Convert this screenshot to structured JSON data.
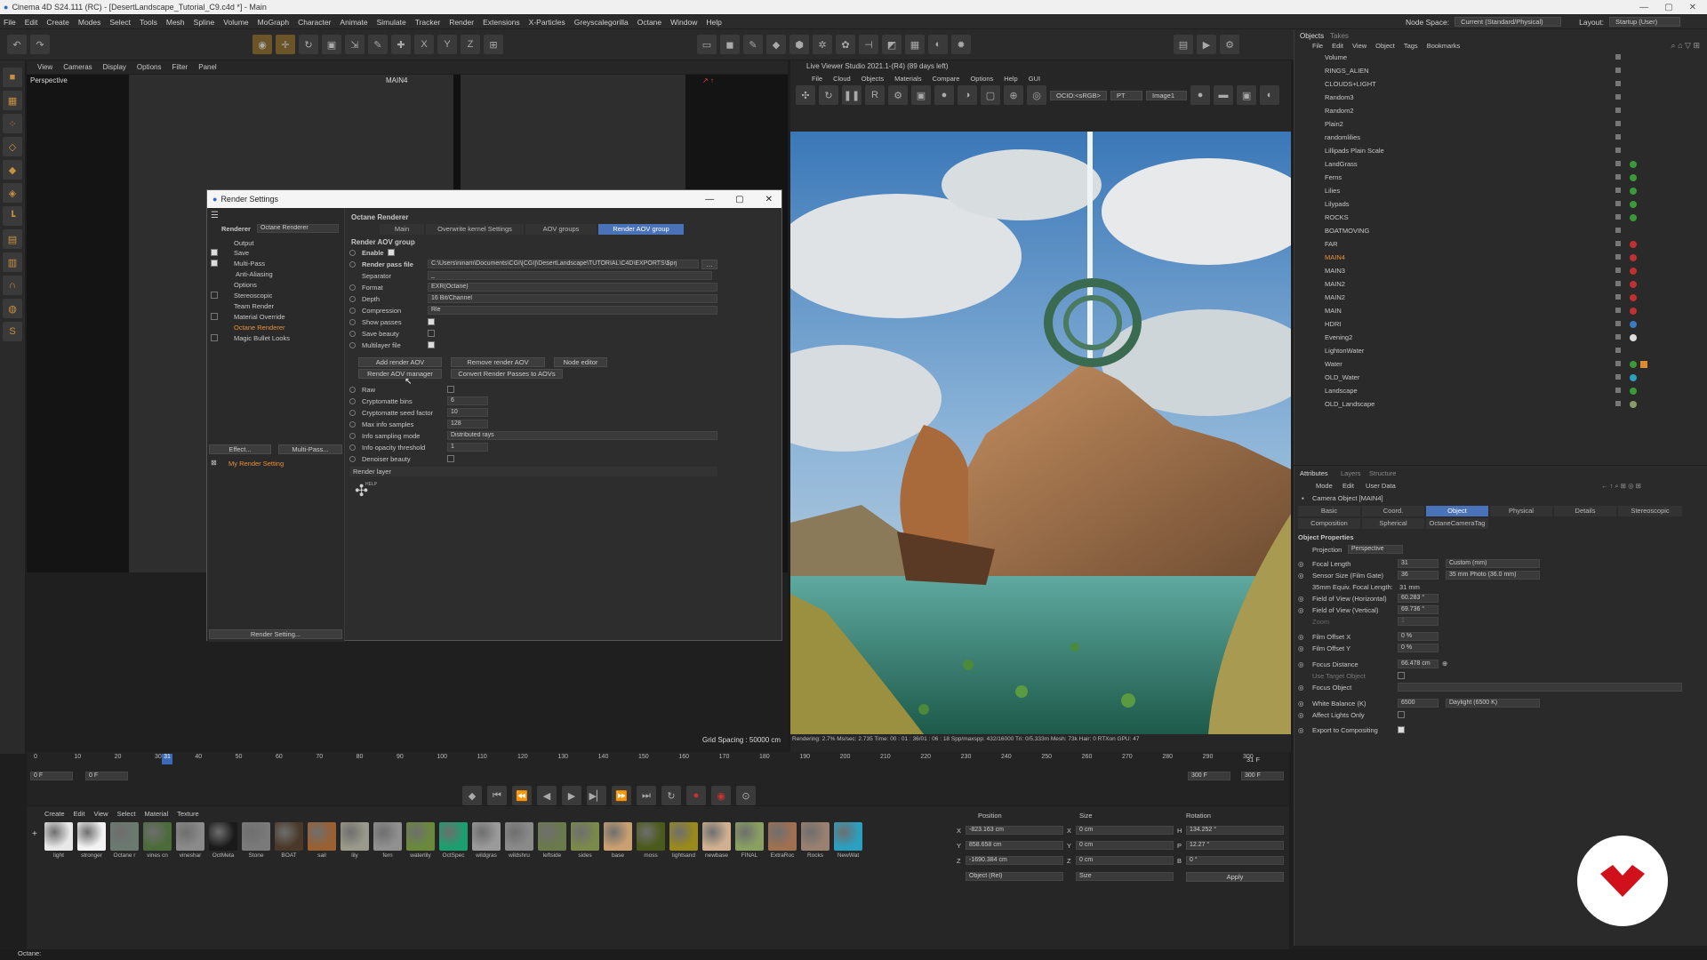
{
  "window": {
    "title": "Cinema 4D S24.111 (RC) - [DesertLandscape_Tutorial_C9.c4d *] - Main"
  },
  "menubar": {
    "items": [
      "File",
      "Edit",
      "Create",
      "Modes",
      "Select",
      "Tools",
      "Mesh",
      "Spline",
      "Volume",
      "MoGraph",
      "Character",
      "Animate",
      "Simulate",
      "Tracker",
      "Render",
      "Extensions",
      "X-Particles",
      "Greyscalegorilla",
      "Octane",
      "Window",
      "Help"
    ],
    "node_space_label": "Node Space:",
    "node_space_value": "Current (Standard/Physical)",
    "layout_label": "Layout:",
    "layout_value": "Startup (User)"
  },
  "viewport": {
    "menu": [
      "View",
      "Cameras",
      "Display",
      "Options",
      "Filter",
      "Panel"
    ],
    "name": "Perspective",
    "camera_label": "MAIN4",
    "grid_spacing": "Grid Spacing : 50000 cm"
  },
  "render_settings": {
    "title": "Render Settings",
    "renderer_label": "Renderer",
    "renderer_value": "Octane Renderer",
    "tree": [
      "Output",
      "Save",
      "Multi-Pass",
      "Anti-Aliasing",
      "Options",
      "Stereoscopic",
      "Team Render",
      "Material Override",
      "Octane Renderer",
      "Magic Bullet Looks"
    ],
    "effect_button": "Effect...",
    "multipass_button": "Multi-Pass...",
    "preset_name": "My Render Setting",
    "render_setting_button": "Render Setting...",
    "section_title": "Octane Renderer",
    "tabs": [
      "Main",
      "Overwrite kernel Settings",
      "AOV groups",
      "Render AOV group"
    ],
    "group_title": "Render AOV group",
    "enable_label": "Enable",
    "render_pass_file_label": "Render pass file",
    "render_pass_file_value": "C:\\Users\\ninam\\Documents\\CGI\\[CGI]\\DesertLandscape\\TUTORIAL\\C4D\\EXPORTS\\$prj",
    "separator_label": "Separator",
    "separator_value": "_",
    "format_label": "Format",
    "format_value": "EXR(Octane)",
    "depth_label": "Depth",
    "depth_value": "16 Bit/Channel",
    "compression_label": "Compression",
    "compression_value": "Rle",
    "show_passes_label": "Show passes",
    "save_beauty_label": "Save beauty",
    "multilayer_label": "Multilayer file",
    "add_aov_button": "Add render AOV",
    "remove_aov_button": "Remove render AOV",
    "node_editor_button": "Node editor",
    "aov_manager_button": "Render AOV manager",
    "convert_button": "Convert Render Passes to AOVs",
    "raw_label": "Raw",
    "crypto_bins_label": "Cryptomatte bins",
    "crypto_bins_value": "6",
    "crypto_seed_label": "Cryptomatte seed factor",
    "crypto_seed_value": "10",
    "max_info_label": "Max info samples",
    "max_info_value": "128",
    "info_sampling_label": "Info sampling mode",
    "info_sampling_value": "Distributed rays",
    "info_opacity_label": "Info opacity threshold",
    "info_opacity_value": "1",
    "denoiser_label": "Denoiser beauty",
    "render_layer_label": "Render layer",
    "help_label": "HELP"
  },
  "live_viewer": {
    "title": "Live Viewer Studio 2021.1-(R4) (89 days left)",
    "menu": [
      "File",
      "Cloud",
      "Objects",
      "Materials",
      "Compare",
      "Options",
      "Help",
      "GUI"
    ],
    "ocio_value": "OCIO:<sRGB>",
    "pt_value": "PT",
    "image_value": "Image1",
    "status": "Rendering: 2.7%  Ms/sec: 2.735  Time: 00 : 01 : 36/01 : 06 : 18  Spp/maxspp: 432/16000  Tri: 0/5.333m  Mesh: 73k  Hair: 0  RTXon  GPU: 47"
  },
  "objects_panel": {
    "tabs": [
      "Objects",
      "Takes"
    ],
    "menu": [
      "File",
      "Edit",
      "View",
      "Object",
      "Tags",
      "Bookmarks"
    ],
    "items": [
      {
        "name": "Volume",
        "highlight": false
      },
      {
        "name": "RINGS_ALIEN",
        "highlight": false
      },
      {
        "name": "CLOUDS+LIGHT",
        "highlight": false
      },
      {
        "name": "Random3",
        "highlight": false
      },
      {
        "name": "Random2",
        "highlight": false
      },
      {
        "name": "Plain2",
        "highlight": false
      },
      {
        "name": "randomlilies",
        "highlight": false
      },
      {
        "name": "Lillipads Plain Scale",
        "highlight": false
      },
      {
        "name": "LandGrass",
        "highlight": false
      },
      {
        "name": "Ferns",
        "highlight": false
      },
      {
        "name": "Lilies",
        "highlight": false
      },
      {
        "name": "Lilypads",
        "highlight": false
      },
      {
        "name": "ROCKS",
        "highlight": false
      },
      {
        "name": "BOATMOVING",
        "highlight": false
      },
      {
        "name": "FAR",
        "highlight": false
      },
      {
        "name": "MAIN4",
        "highlight": true
      },
      {
        "name": "MAIN3",
        "highlight": false
      },
      {
        "name": "MAIN2",
        "highlight": false
      },
      {
        "name": "MAIN2",
        "highlight": false
      },
      {
        "name": "MAIN",
        "highlight": false
      },
      {
        "name": "HDRI",
        "highlight": false
      },
      {
        "name": "Evening2",
        "highlight": false
      },
      {
        "name": "LightonWater",
        "highlight": false
      },
      {
        "name": "Water",
        "highlight": false
      },
      {
        "name": "OLD_Water",
        "highlight": false
      },
      {
        "name": "Landscape",
        "highlight": false
      },
      {
        "name": "OLD_Landscape",
        "highlight": false
      }
    ]
  },
  "attributes": {
    "tabs": [
      "Attributes",
      "Layers",
      "Structure"
    ],
    "menu": [
      "Mode",
      "Edit",
      "User Data"
    ],
    "object_title": "Camera Object [MAIN4]",
    "subtabs_row1": [
      "Basic",
      "Coord.",
      "Object",
      "Physical",
      "Details",
      "Stereoscopic"
    ],
    "subtabs_row2": [
      "Composition",
      "Spherical",
      "OctaneCameraTag"
    ],
    "section": "Object Properties",
    "projection_label": "Projection",
    "projection_value": "Perspective",
    "focal_label": "Focal Length",
    "focal_value": "31",
    "focal_preset": "Custom (mm)",
    "sensor_label": "Sensor Size (Film Gate)",
    "sensor_value": "36",
    "sensor_preset": "35 mm Photo (36.0 mm)",
    "equiv_label": "35mm Equiv. Focal Length:",
    "equiv_value": "31 mm",
    "fovh_label": "Field of View (Horizontal)",
    "fovh_value": "60.283 °",
    "fovv_label": "Field of View (Vertical)",
    "fovv_value": "69.736 °",
    "zoom_label": "Zoom",
    "zoom_value": "1",
    "fox_label": "Film Offset X",
    "fox_value": "0 %",
    "foy_label": "Film Offset Y",
    "foy_value": "0 %",
    "focus_label": "Focus Distance",
    "focus_value": "66.478 cm",
    "use_target_label": "Use Target Object",
    "focus_obj_label": "Focus Object",
    "wb_label": "White Balance (K)",
    "wb_value": "6500",
    "wb_preset": "Daylight (6500 K)",
    "affect_label": "Affect Lights Only",
    "export_label": "Export to Compositing"
  },
  "timeline": {
    "ticks": [
      "0",
      "10",
      "20",
      "30",
      "40",
      "50",
      "60",
      "70",
      "80",
      "90",
      "100",
      "110",
      "120",
      "130",
      "140",
      "150",
      "160",
      "170",
      "180",
      "190",
      "200",
      "210",
      "220",
      "230",
      "240",
      "250",
      "260",
      "270",
      "280",
      "290",
      "300"
    ],
    "current_frame": "31 F",
    "start_a": "0 F",
    "start_b": "0 F",
    "end_a": "300 F",
    "end_b": "300 F",
    "marker": "31"
  },
  "materials": {
    "menu": [
      "Create",
      "Edit",
      "View",
      "Select",
      "Material",
      "Texture"
    ],
    "items": [
      {
        "name": "light",
        "color": "#e8e8e8"
      },
      {
        "name": "stronger",
        "color": "#f2f2f2"
      },
      {
        "name": "Octane r",
        "color": "#6a7a70"
      },
      {
        "name": "vines cn",
        "color": "#4b6b3a"
      },
      {
        "name": "vineshar",
        "color": "#8a8a8a"
      },
      {
        "name": "OctMeta",
        "color": "#1a1a1a"
      },
      {
        "name": "Stone",
        "color": "#7a7a7a"
      },
      {
        "name": "BOAT",
        "color": "#4a3828"
      },
      {
        "name": "sail",
        "color": "#9a6030"
      },
      {
        "name": "lily",
        "color": "#9a9a8a"
      },
      {
        "name": "fern",
        "color": "#909090"
      },
      {
        "name": "waterlily",
        "color": "#6a8a3a"
      },
      {
        "name": "OctSpec",
        "color": "#1aa070"
      },
      {
        "name": "wildgras",
        "color": "#9a9a9a"
      },
      {
        "name": "wildshru",
        "color": "#8a8a8a"
      },
      {
        "name": "leftside",
        "color": "#6a7a4a"
      },
      {
        "name": "sides",
        "color": "#7a8a4a"
      },
      {
        "name": "base",
        "color": "#caa070"
      },
      {
        "name": "moss",
        "color": "#4a5a1a"
      },
      {
        "name": "lightsand",
        "color": "#9a8a1a"
      },
      {
        "name": "newbase",
        "color": "#d0b090"
      },
      {
        "name": "FINAL",
        "color": "#8aa060"
      },
      {
        "name": "ExtraRoc",
        "color": "#a07050"
      },
      {
        "name": "Rocks",
        "color": "#9a8070"
      },
      {
        "name": "NewWat",
        "color": "#2aa0c0"
      }
    ]
  },
  "coords": {
    "headers": [
      "Position",
      "Size",
      "Rotation"
    ],
    "x_pos": "-823.163 cm",
    "y_pos": "858.658 cm",
    "z_pos": "-1690.384 cm",
    "x_size": "0 cm",
    "y_size": "0 cm",
    "z_size": "0 cm",
    "h_rot": "134.252 °",
    "p_rot": "12.27 °",
    "b_rot": "0 °",
    "mode_value": "Object (Rel)",
    "size_value": "Size",
    "apply_button": "Apply"
  },
  "statusbar": {
    "text": "Octane:"
  }
}
